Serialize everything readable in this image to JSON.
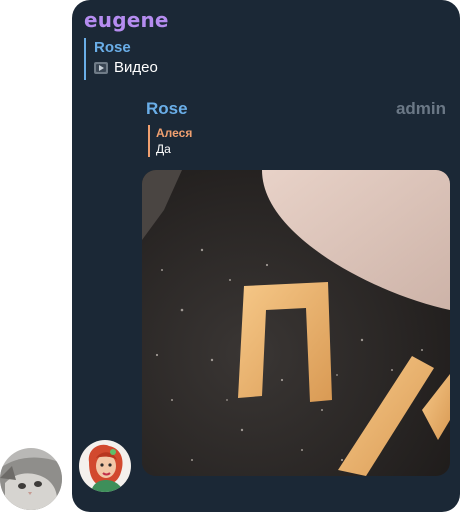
{
  "message": {
    "sender": "eugene",
    "reply": {
      "author": "Rose",
      "text": "Видео",
      "icon": "video-icon"
    },
    "forwarded": {
      "author": "Rose",
      "badge": "admin",
      "reply": {
        "author": "Алеся",
        "text": "Да"
      },
      "media": {
        "type": "video",
        "letters": "ПИ"
      }
    }
  },
  "colors": {
    "bubble": "#1b2836",
    "sender": "#b58cf0",
    "reply_accent": "#6aaee8",
    "inner_reply_accent": "#f0a070",
    "admin": "#6b7886"
  }
}
